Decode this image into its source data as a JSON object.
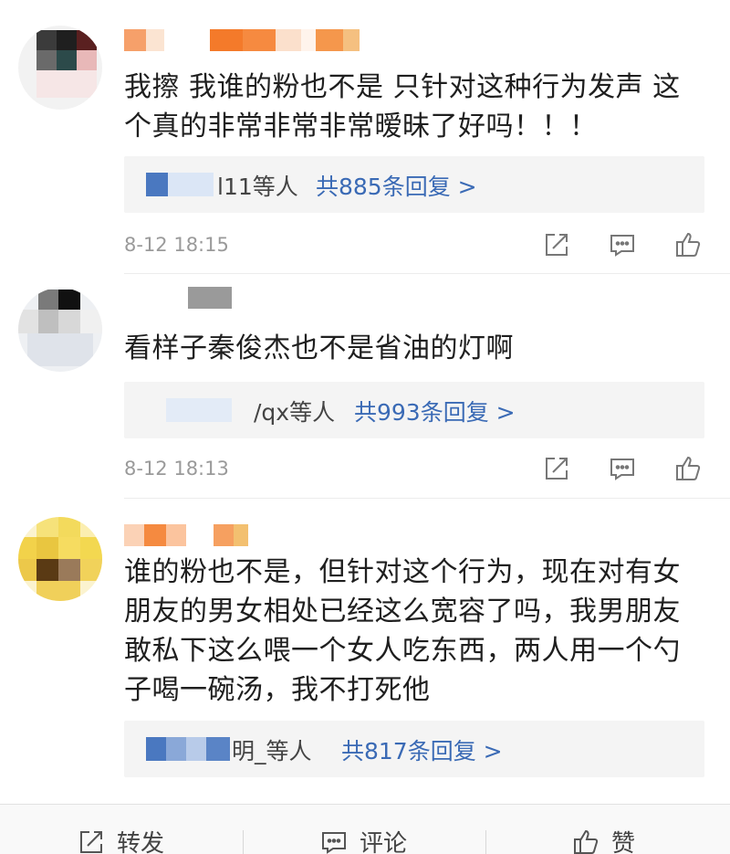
{
  "comments": [
    {
      "text": "我擦 我谁的粉也不是 只针对这种行为发声 这个真的非常非常非常暧昧了好吗！！！",
      "reply_who": "l11等人",
      "reply_count": "共885条回复 >",
      "time": "8-12 18:15"
    },
    {
      "text": "看样子秦俊杰也不是省油的灯啊",
      "reply_who": "/qx等人",
      "reply_count": "共993条回复 >",
      "time": "8-12 18:13"
    },
    {
      "text": "谁的粉也不是，但针对这个行为，现在对有女朋友的男女相处已经这么宽容了吗，我男朋友敢私下这么喂一个女人吃东西，两人用一个勺子喝一碗汤，我不打死他",
      "reply_who": "明_等人",
      "reply_count": "共817条回复 >"
    }
  ],
  "bottom_bar": {
    "repost_label": "转发",
    "comment_label": "评论",
    "like_label": "赞"
  },
  "icons": {
    "repost": "repost-icon",
    "comment": "comment-icon",
    "like": "thumbs-up-icon"
  },
  "colors": {
    "link": "#3a6ab5",
    "meta": "#9a9a9a",
    "reply_bg": "#f4f4f4"
  }
}
